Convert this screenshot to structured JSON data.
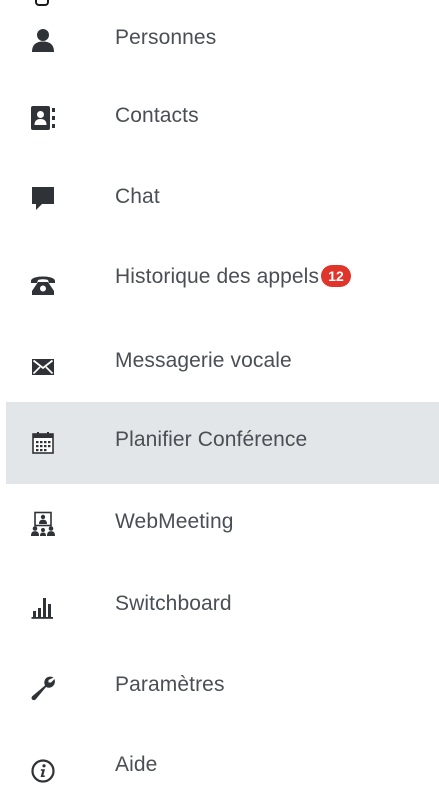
{
  "menu": {
    "items": [
      {
        "label": "Personnes",
        "icon": "person-icon"
      },
      {
        "label": "Contacts",
        "icon": "address-book-icon"
      },
      {
        "label": "Chat",
        "icon": "chat-bubble-icon"
      },
      {
        "label": "Historique des appels",
        "icon": "telephone-icon",
        "badge": "12"
      },
      {
        "label": "Messagerie vocale",
        "icon": "envelope-icon"
      },
      {
        "label": "Planifier Conférence",
        "icon": "calendar-icon",
        "active": true
      },
      {
        "label": "WebMeeting",
        "icon": "webmeeting-icon"
      },
      {
        "label": "Switchboard",
        "icon": "bar-chart-icon"
      },
      {
        "label": "Paramètres",
        "icon": "wrench-icon"
      },
      {
        "label": "Aide",
        "icon": "info-icon"
      }
    ]
  },
  "colors": {
    "text": "#4a4f55",
    "icon": "#2f3337",
    "active_bg": "#e2e6e9",
    "badge_bg": "#e0352b"
  }
}
